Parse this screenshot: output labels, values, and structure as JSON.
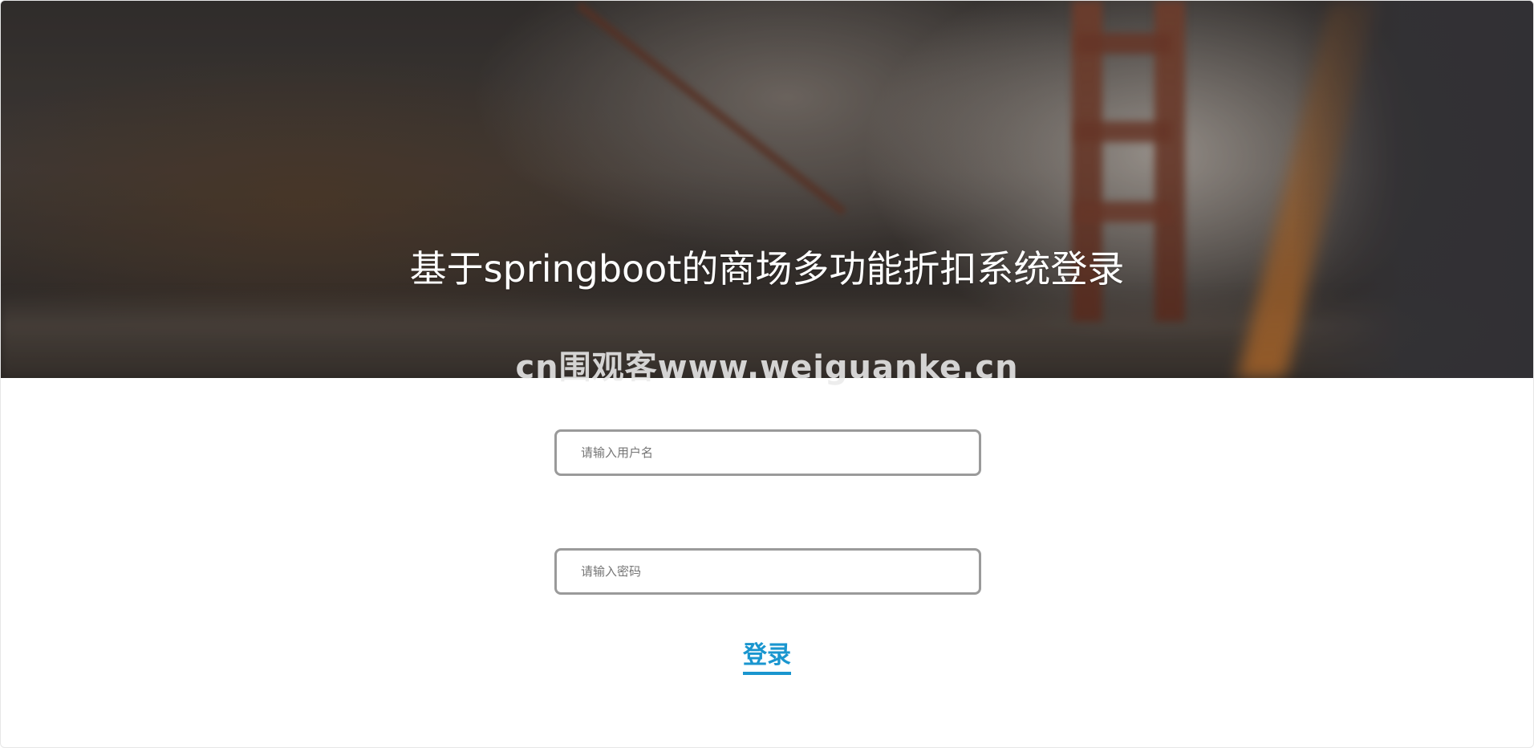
{
  "hero": {
    "title": "基于springboot的商场多功能折扣系统登录",
    "background": "blurred-bridge-photo"
  },
  "watermark": {
    "text": "cn围观客www.weiguanke.cn"
  },
  "form": {
    "username": {
      "placeholder": "请输入用户名",
      "value": ""
    },
    "password": {
      "placeholder": "请输入密码",
      "value": ""
    },
    "submit_label": "登录"
  },
  "colors": {
    "accent": "#1a96cf",
    "input_border": "#9a9a9a",
    "title_text": "#ffffff"
  }
}
